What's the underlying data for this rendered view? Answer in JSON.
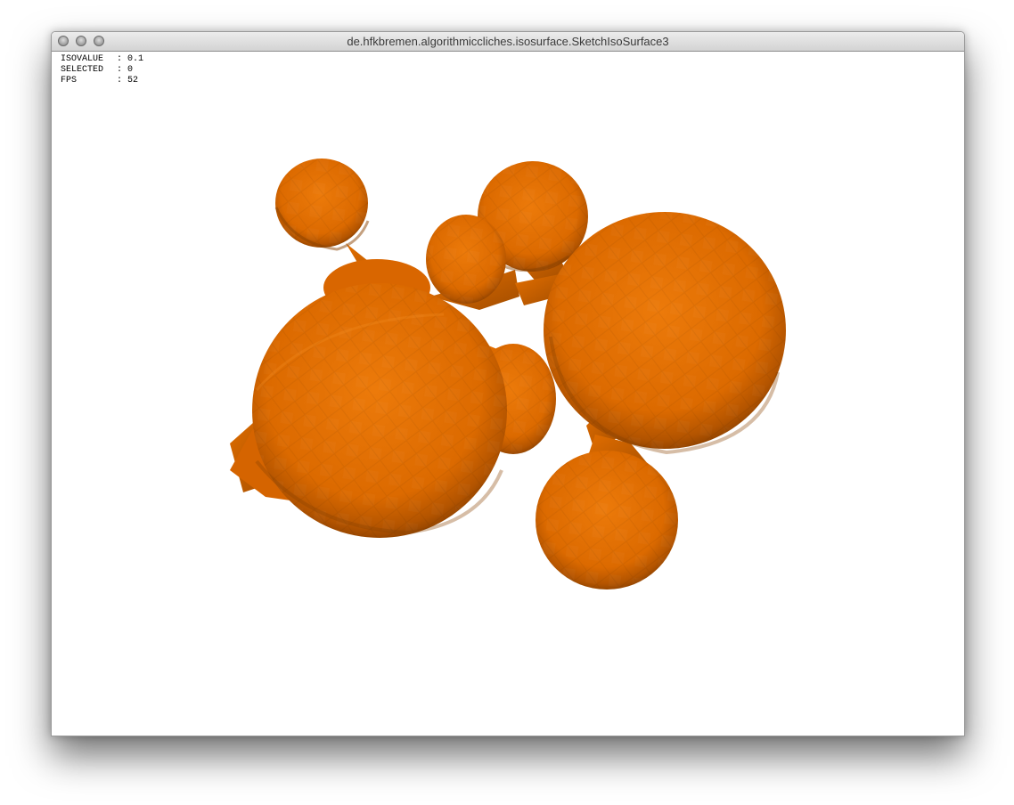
{
  "window": {
    "title": "de.hfkbremen.algorithmiccliches.isosurface.SketchIsoSurface3"
  },
  "hud": [
    {
      "key": "ISOVALUE",
      "value": "0.1"
    },
    {
      "key": "SELECTED",
      "value": "0"
    },
    {
      "key": "FPS",
      "value": "52"
    }
  ],
  "colors": {
    "blob_fill": "#e06d00",
    "blob_dark": "#8c4200",
    "blob_light": "#f08a20",
    "background": "#ffffff"
  }
}
